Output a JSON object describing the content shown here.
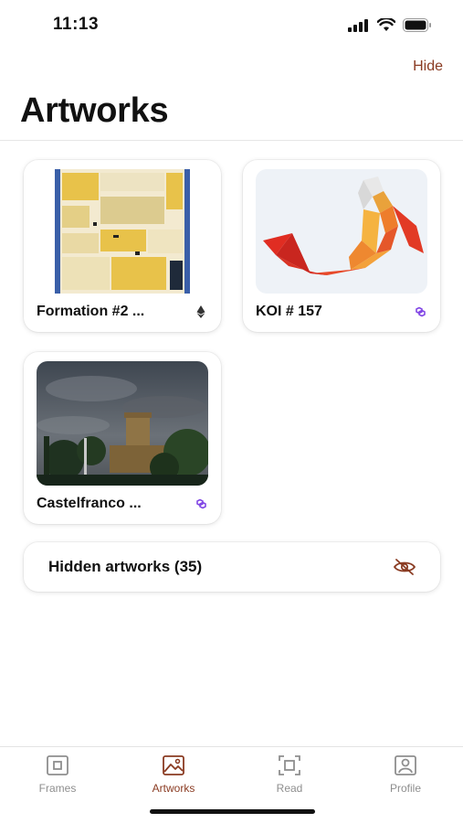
{
  "status_bar": {
    "time": "11:13"
  },
  "header": {
    "hide_label": "Hide",
    "title": "Artworks"
  },
  "artworks": [
    {
      "title": "Formation #2 ...",
      "chain_icon": "ethereum-icon"
    },
    {
      "title": "KOI # 157",
      "chain_icon": "polygon-icon"
    },
    {
      "title": "Castelfranco ...",
      "chain_icon": "polygon-icon"
    }
  ],
  "hidden_artworks": {
    "label": "Hidden artworks (35)",
    "icon": "eye-slash-icon"
  },
  "tabs": [
    {
      "label": "Frames",
      "icon": "frame-icon",
      "active": false
    },
    {
      "label": "Artworks",
      "icon": "image-icon",
      "active": true
    },
    {
      "label": "Read",
      "icon": "scan-icon",
      "active": false
    },
    {
      "label": "Profile",
      "icon": "profile-icon",
      "active": false
    }
  ],
  "colors": {
    "accent": "#8a3b22",
    "polygon": "#8247e5",
    "inactive_tab": "#8e8e8e"
  }
}
